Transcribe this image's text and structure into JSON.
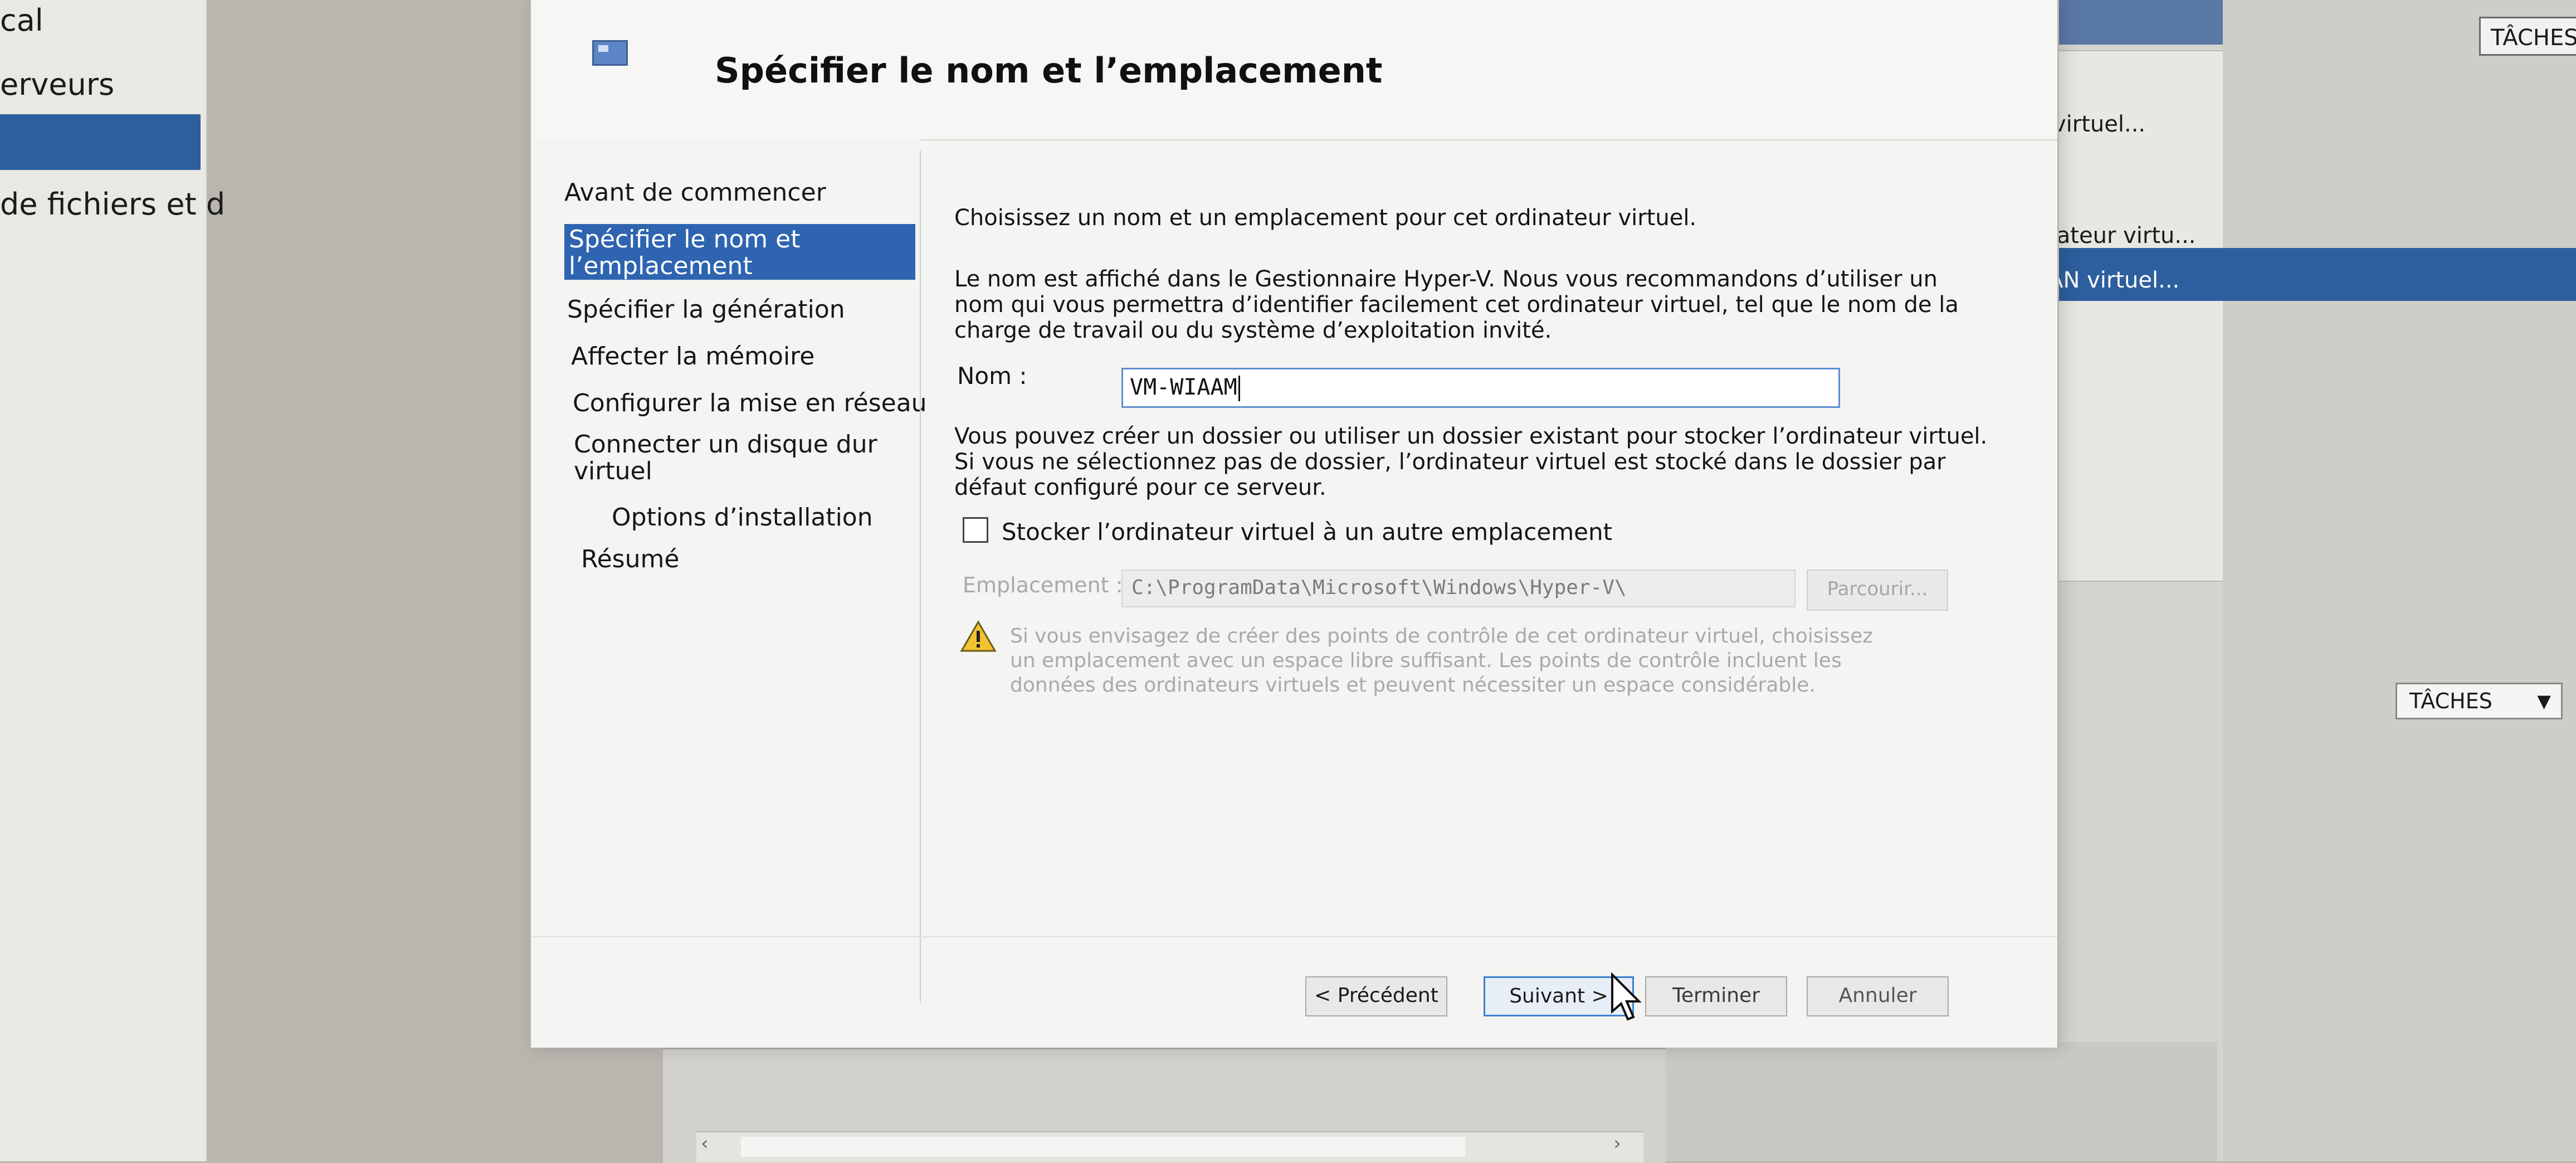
{
  "background": {
    "left_items": [
      "cal",
      "erveurs",
      "de fichiers et d"
    ],
    "right_items": [
      "virtuel...",
      "itateur virtu...",
      "SAN virtuel..."
    ],
    "taches_top": "TÂCHES",
    "taches_mid": "TÂCHES"
  },
  "wizard": {
    "title": "Spécifier le nom et l’emplacement",
    "nav": [
      {
        "label": "Avant de commencer"
      },
      {
        "label": "Spécifier le nom et l’emplacement",
        "selected": true
      },
      {
        "label": "Spécifier la génération"
      },
      {
        "label": "Affecter la mémoire"
      },
      {
        "label": "Configurer la mise en réseau"
      },
      {
        "label": "Connecter un disque dur virtuel"
      },
      {
        "label": "Options d’installation"
      },
      {
        "label": "Résumé"
      }
    ],
    "intro": "Choisissez un nom et un emplacement pour cet ordinateur virtuel.",
    "description": "Le nom est affiché dans le Gestionnaire Hyper-V. Nous vous recommandons d’utiliser un nom qui vous permettra d’identifier facilement cet ordinateur virtuel, tel que le nom de la charge de travail ou du système d’exploitation invité.",
    "name_label": "Nom :",
    "name_value": "VM-WIAAM",
    "folder_text": "Vous pouvez créer un dossier ou utiliser un dossier existant pour stocker l’ordinateur virtuel. Si vous ne sélectionnez pas de dossier, l’ordinateur virtuel est stocké dans le dossier par défaut configuré pour ce serveur.",
    "checkbox_label": "Stocker l’ordinateur virtuel à un autre emplacement",
    "checkbox_checked": false,
    "location_label": "Emplacement :",
    "location_value": "C:\\ProgramData\\Microsoft\\Windows\\Hyper-V\\",
    "browse_label": "Parcourir...",
    "warning": "Si vous envisagez de créer des points de contrôle de cet ordinateur virtuel, choisissez un emplacement avec un espace libre suffisant. Les points de contrôle incluent les données des ordinateurs virtuels et peuvent nécessiter un espace considérable.",
    "buttons": {
      "previous": "< Précédent",
      "next": "Suivant >",
      "finish": "Terminer",
      "cancel": "Annuler"
    }
  },
  "colors": {
    "selection_blue": "#2e64b0",
    "focus_border": "#3c7fd2"
  }
}
